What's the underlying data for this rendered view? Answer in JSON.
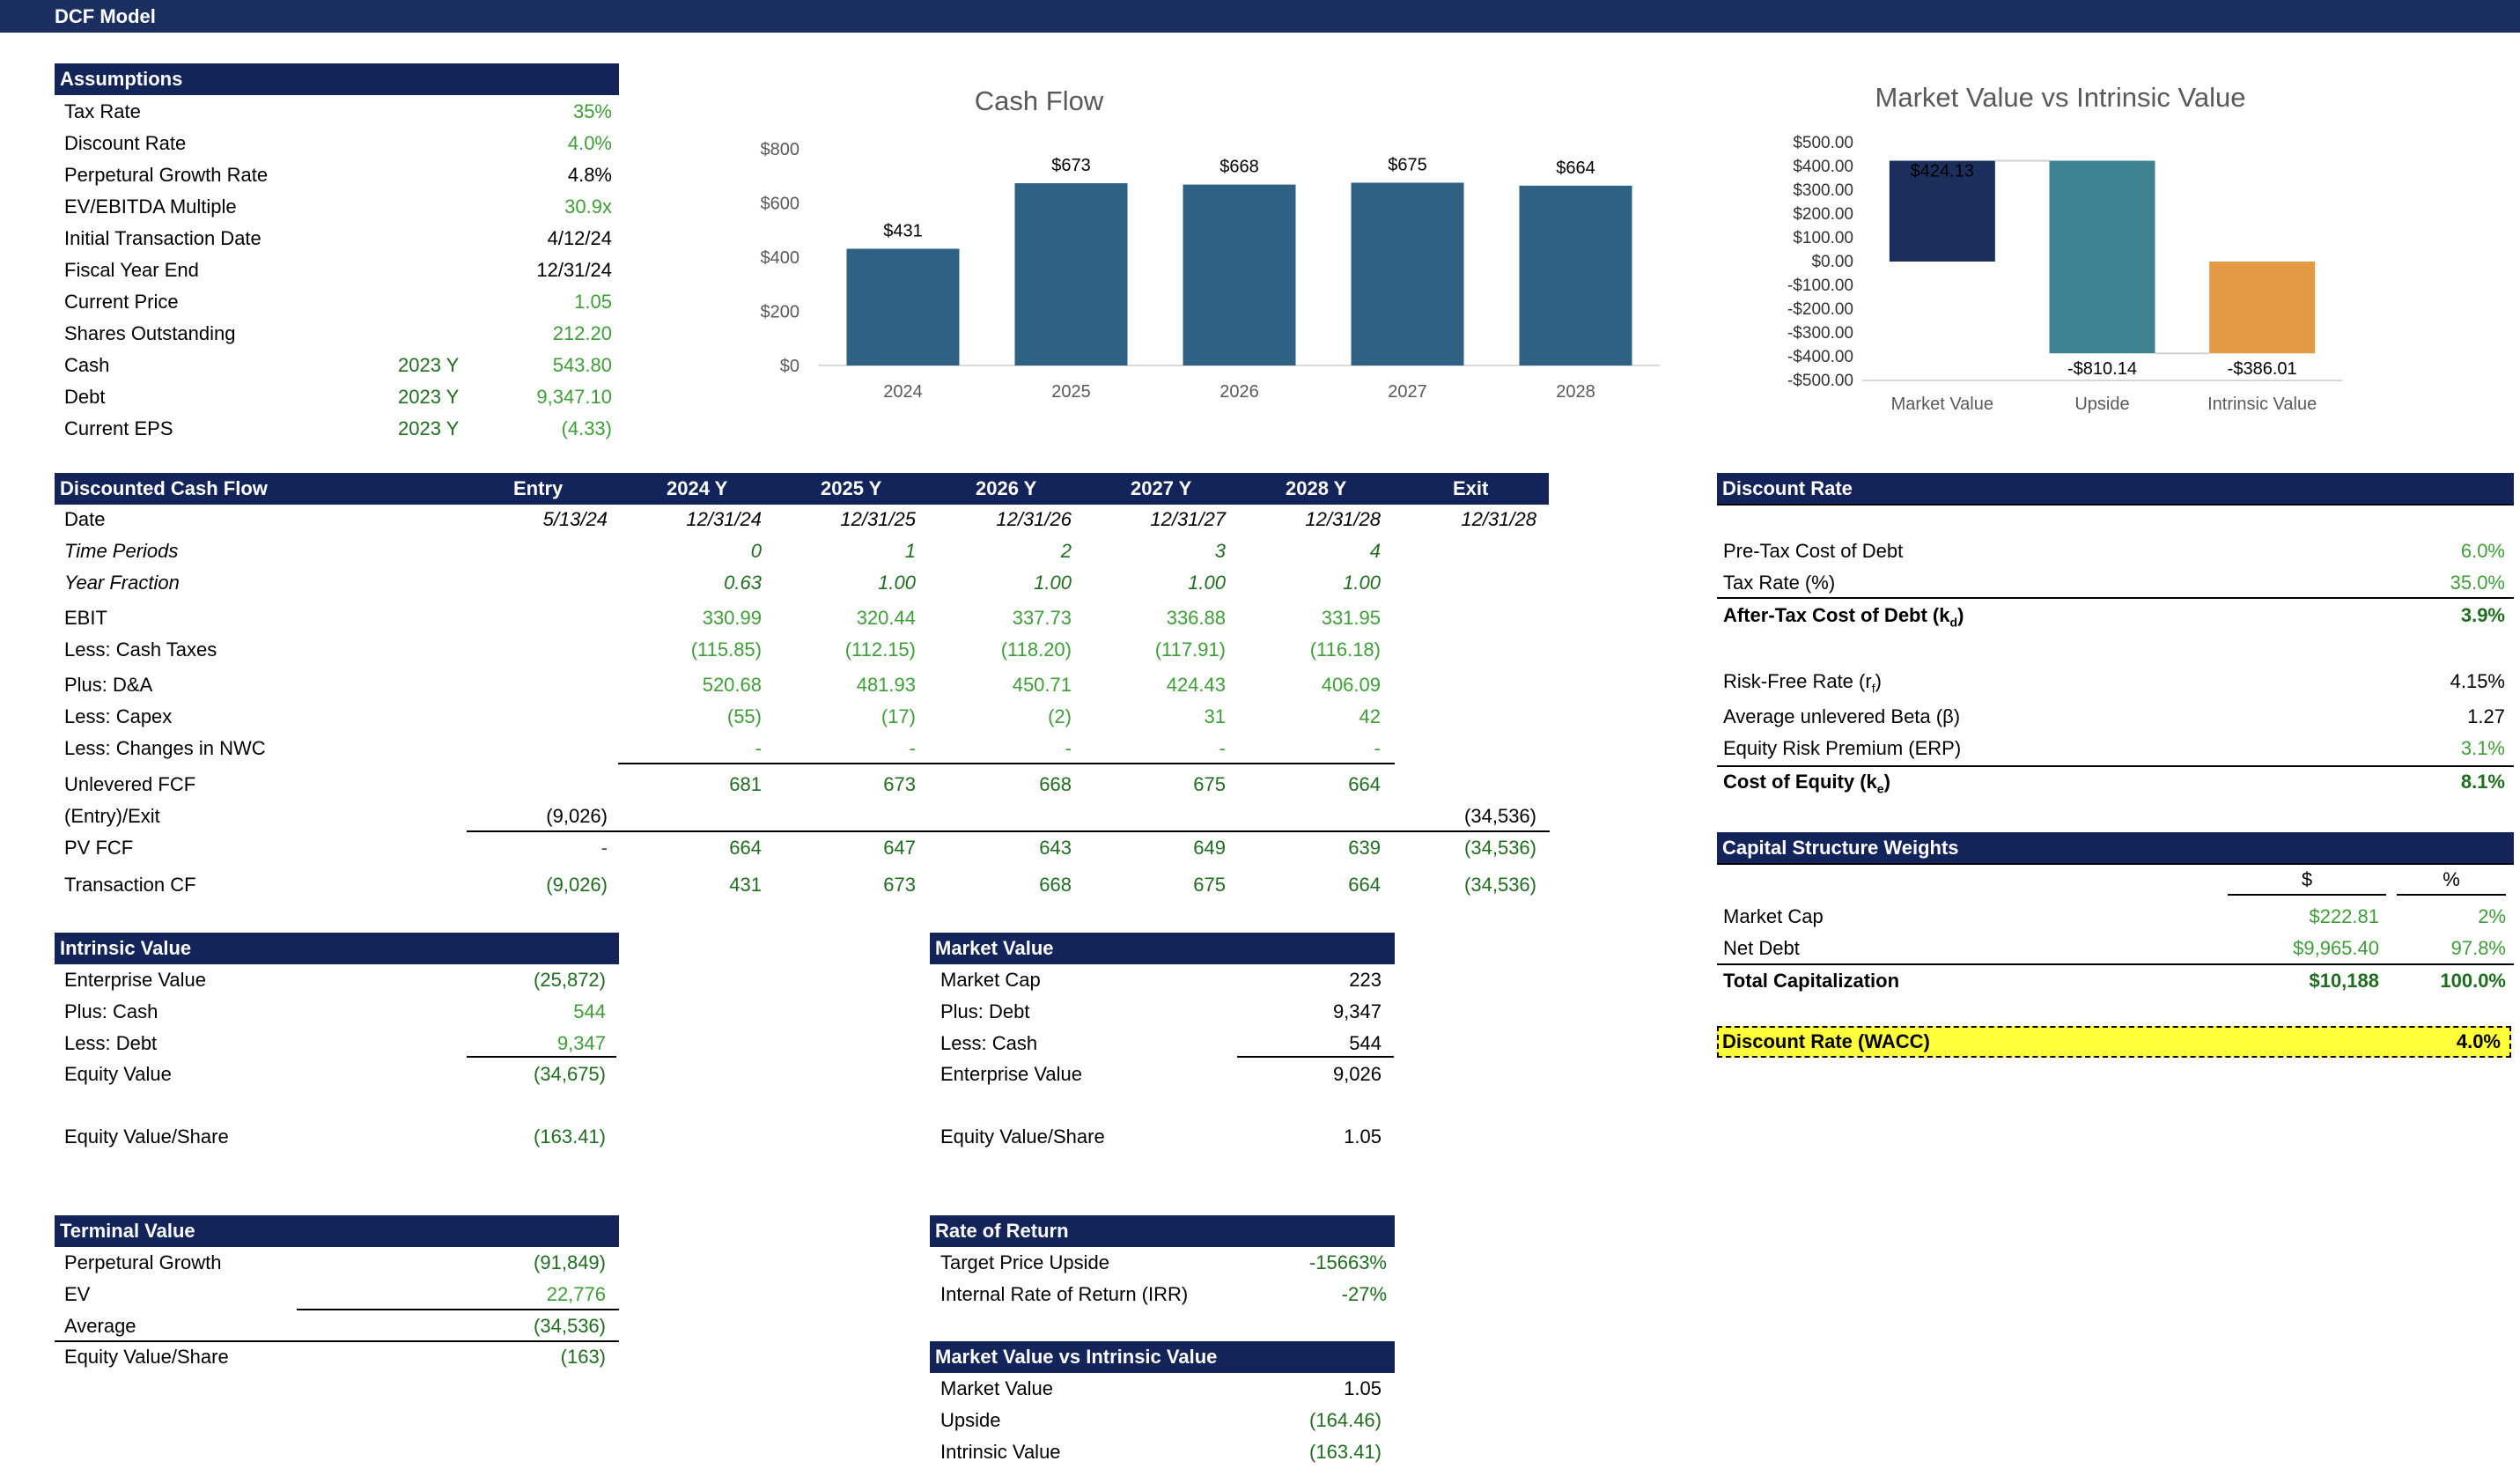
{
  "title": "DCF Model",
  "assumptions": {
    "header": "Assumptions",
    "rows": [
      {
        "label": "Tax Rate",
        "period": "",
        "value": "35%",
        "color": "green"
      },
      {
        "label": "Discount Rate",
        "period": "",
        "value": "4.0%",
        "color": "green"
      },
      {
        "label": "Perpetural Growth Rate",
        "period": "",
        "value": "4.8%",
        "color": "black"
      },
      {
        "label": "EV/EBITDA Multiple",
        "period": "",
        "value": "30.9x",
        "color": "green"
      },
      {
        "label": "Initial Transaction Date",
        "period": "",
        "value": "4/12/24",
        "color": "black"
      },
      {
        "label": "Fiscal Year End",
        "period": "",
        "value": "12/31/24",
        "color": "black"
      },
      {
        "label": "Current Price",
        "period": "",
        "value": "1.05",
        "color": "green"
      },
      {
        "label": "Shares Outstanding",
        "period": "",
        "value": "212.20",
        "color": "green"
      },
      {
        "label": "Cash",
        "period": "2023 Y",
        "value": "543.80",
        "color": "green"
      },
      {
        "label": "Debt",
        "period": "2023 Y",
        "value": "9,347.10",
        "color": "green"
      },
      {
        "label": "Current EPS",
        "period": "2023 Y",
        "value": "(4.33)",
        "color": "green"
      }
    ]
  },
  "dcf": {
    "header": "Discounted Cash Flow",
    "columns": [
      "Entry",
      "2024 Y",
      "2025 Y",
      "2026 Y",
      "2027 Y",
      "2028 Y",
      "Exit"
    ],
    "rows": [
      {
        "label": "Date",
        "cells": [
          "5/13/24",
          "12/31/24",
          "12/31/25",
          "12/31/26",
          "12/31/27",
          "12/31/28",
          "12/31/28"
        ]
      },
      {
        "label": "Time Periods",
        "cells": [
          "",
          "0",
          "1",
          "2",
          "3",
          "4",
          ""
        ]
      },
      {
        "label": "Year Fraction",
        "cells": [
          "",
          "0.63",
          "1.00",
          "1.00",
          "1.00",
          "1.00",
          ""
        ]
      },
      {
        "label": "EBIT",
        "cells": [
          "",
          "330.99",
          "320.44",
          "337.73",
          "336.88",
          "331.95",
          ""
        ]
      },
      {
        "label": "Less: Cash Taxes",
        "cells": [
          "",
          "(115.85)",
          "(112.15)",
          "(118.20)",
          "(117.91)",
          "(116.18)",
          ""
        ]
      },
      {
        "label": "Plus: D&A",
        "cells": [
          "",
          "520.68",
          "481.93",
          "450.71",
          "424.43",
          "406.09",
          ""
        ]
      },
      {
        "label": "Less: Capex",
        "cells": [
          "",
          "(55)",
          "(17)",
          "(2)",
          "31",
          "42",
          ""
        ]
      },
      {
        "label": "Less: Changes in NWC",
        "cells": [
          "",
          "-",
          "-",
          "-",
          "-",
          "-",
          ""
        ]
      },
      {
        "label": "Unlevered FCF",
        "cells": [
          "",
          "681",
          "673",
          "668",
          "675",
          "664",
          ""
        ]
      },
      {
        "label": "(Entry)/Exit",
        "cells": [
          "(9,026)",
          "",
          "",
          "",
          "",
          "",
          "(34,536)"
        ]
      },
      {
        "label": "PV FCF",
        "cells": [
          "-",
          "664",
          "647",
          "643",
          "649",
          "639",
          "(34,536)"
        ]
      },
      {
        "label": "Transaction CF",
        "cells": [
          "(9,026)",
          "431",
          "673",
          "668",
          "675",
          "664",
          "(34,536)"
        ]
      }
    ]
  },
  "intrinsic": {
    "header": "Intrinsic Value",
    "rows": [
      {
        "label": "Enterprise Value",
        "value": "(25,872)"
      },
      {
        "label": "Plus: Cash",
        "value": "544"
      },
      {
        "label": "Less: Debt",
        "value": "9,347"
      },
      {
        "label": "Equity Value",
        "value": "(34,675)"
      },
      {
        "label": "Equity Value/Share",
        "value": "(163.41)"
      }
    ]
  },
  "market": {
    "header": "Market Value",
    "rows": [
      {
        "label": "Market Cap",
        "value": "223"
      },
      {
        "label": "Plus: Debt",
        "value": "9,347"
      },
      {
        "label": "Less: Cash",
        "value": "544"
      },
      {
        "label": "Enterprise Value",
        "value": "9,026"
      },
      {
        "label": "Equity Value/Share",
        "value": "1.05"
      }
    ]
  },
  "terminal": {
    "header": "Terminal Value",
    "rows": [
      {
        "label": "Perpetural Growth",
        "value": "(91,849)"
      },
      {
        "label": "EV",
        "value": "22,776"
      },
      {
        "label": "Average",
        "value": "(34,536)"
      },
      {
        "label": "Equity Value/Share",
        "value": "(163)"
      }
    ]
  },
  "ror": {
    "header": "Rate of Return",
    "rows": [
      {
        "label": "Target Price Upside",
        "value": "-15663%"
      },
      {
        "label": "Internal Rate of Return (IRR)",
        "value": "-27%"
      }
    ]
  },
  "mvi": {
    "header": "Market Value vs Intrinsic Value",
    "rows": [
      {
        "label": "Market Value",
        "value": "1.05"
      },
      {
        "label": "Upside",
        "value": "(164.46)"
      },
      {
        "label": "Intrinsic Value",
        "value": "(163.41)"
      }
    ]
  },
  "discount": {
    "header": "Discount Rate",
    "debt_rows": [
      {
        "label": "Pre-Tax Cost of Debt",
        "value": "6.0%"
      },
      {
        "label": "Tax Rate (%)",
        "value": "35.0%"
      }
    ],
    "after_tax_label": "After-Tax Cost of Debt (k",
    "after_tax_sub": "d",
    "after_tax_value": "3.9%",
    "rf_label": "Risk-Free Rate (r",
    "rf_sub": "f",
    "rf_value": "4.15%",
    "beta_label": "Average unlevered Beta (β)",
    "beta_value": "1.27",
    "erp_label": "Equity Risk Premium (ERP)",
    "erp_value": "3.1%",
    "coe_label": "Cost of Equity (k",
    "coe_sub": "e",
    "coe_value": "8.1%"
  },
  "capital": {
    "header": "Capital Structure Weights",
    "col_dollar": "$",
    "col_pct": "%",
    "rows": [
      {
        "label": "Market Cap",
        "dollar": "$222.81",
        "pct": "2%"
      },
      {
        "label": "Net Debt",
        "dollar": "$9,965.40",
        "pct": "97.8%"
      }
    ],
    "total_label": "Total Capitalization",
    "total_dollar": "$10,188",
    "total_pct": "100.0%",
    "wacc_label": "Discount Rate (WACC)",
    "wacc_value": "4.0%"
  },
  "chart_data": [
    {
      "type": "bar",
      "title": "Cash Flow",
      "categories": [
        "2024",
        "2025",
        "2026",
        "2027",
        "2028"
      ],
      "values": [
        431,
        673,
        668,
        675,
        664
      ],
      "value_labels": [
        "$431",
        "$673",
        "$668",
        "$675",
        "$664"
      ],
      "ylim": [
        0,
        800
      ],
      "yticks": [
        "$0",
        "$200",
        "$400",
        "$600",
        "$800"
      ],
      "ytick_values": [
        0,
        200,
        400,
        600,
        800
      ],
      "colors": {
        "bar": "#2e6184"
      },
      "grid": false
    },
    {
      "type": "bar",
      "title": "Market Value vs Intrinsic Value",
      "categories": [
        "Market Value",
        "Upside",
        "Intrinsic Value"
      ],
      "bars": [
        {
          "start": 0,
          "end": 424.13,
          "label": "$424.13",
          "color": "#1c2e5c"
        },
        {
          "start": 424.13,
          "end": -386.01,
          "label": "-$810.14",
          "color": "#3e8291"
        },
        {
          "start": 0,
          "end": -386.01,
          "label": "-$386.01",
          "color": "#e49944"
        }
      ],
      "ylim": [
        -500,
        500
      ],
      "yticks": [
        "$500.00",
        "$400.00",
        "$300.00",
        "$200.00",
        "$100.00",
        "$0.00",
        "-$100.00",
        "-$200.00",
        "-$300.00",
        "-$400.00",
        "-$500.00"
      ],
      "ytick_values": [
        500,
        400,
        300,
        200,
        100,
        0,
        -100,
        -200,
        -300,
        -400,
        -500
      ],
      "grid": false
    }
  ]
}
